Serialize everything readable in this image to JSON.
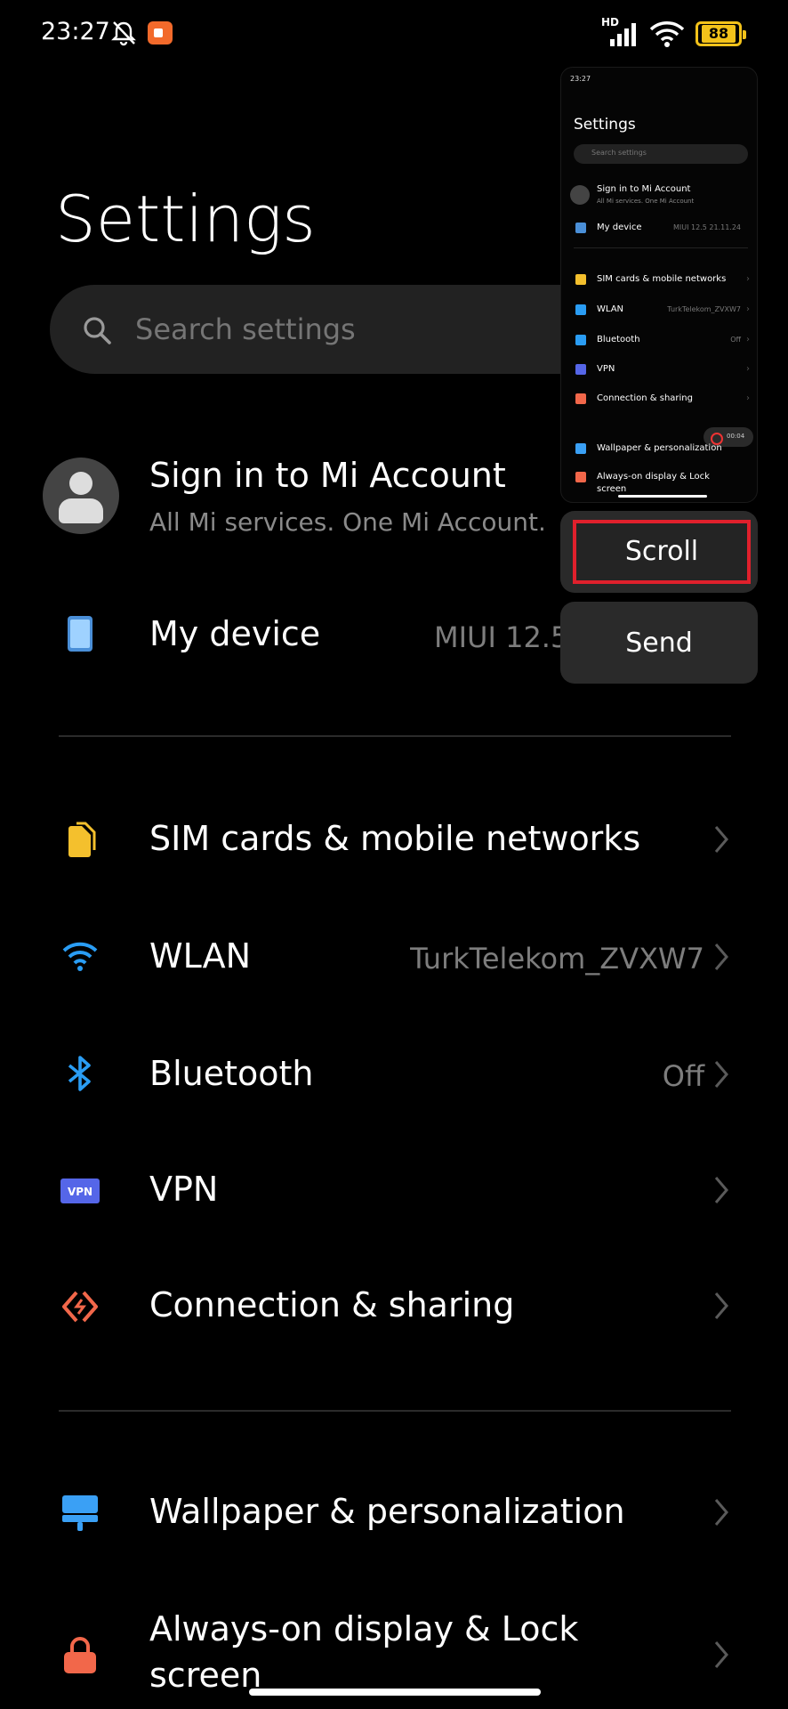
{
  "status_bar": {
    "time": "23:27",
    "network_label": "HD",
    "battery": "88",
    "battery_color": "#f3c21a",
    "icons": [
      "mute-bell-icon",
      "screen-record-icon",
      "signal-icon",
      "wifi-icon",
      "battery-icon"
    ]
  },
  "page": {
    "title": "Settings",
    "search_placeholder": "Search settings"
  },
  "account": {
    "title": "Sign in to Mi Account",
    "subtitle": "All Mi services. One Mi Account."
  },
  "my_device": {
    "label": "My device",
    "value": "MIUI 12.5 21.11.24"
  },
  "network_items": [
    {
      "label": "SIM cards & mobile networks",
      "value": "",
      "icon": "sim-card-icon",
      "color": "#f4c02d"
    },
    {
      "label": "WLAN",
      "value": "TurkTelekom_ZVXW7",
      "icon": "wifi-icon",
      "color": "#2a9df4"
    },
    {
      "label": "Bluetooth",
      "value": "Off",
      "icon": "bluetooth-icon",
      "color": "#2a9df4"
    },
    {
      "label": "VPN",
      "value": "",
      "icon": "vpn-icon",
      "color": "#5566e8"
    },
    {
      "label": "Connection & sharing",
      "value": "",
      "icon": "connection-sharing-icon",
      "color": "#f2674a"
    }
  ],
  "personal_items": [
    {
      "label": "Wallpaper & personalization",
      "value": "",
      "icon": "wallpaper-icon",
      "color": "#3aa0f5"
    },
    {
      "label": "Always-on display & Lock",
      "label2": "screen",
      "value": "",
      "icon": "lock-icon",
      "color": "#f2674a"
    }
  ],
  "overlay": {
    "mini_time": "23:27",
    "mini_title": "Settings",
    "mini_search": "Search settings",
    "mini_account_title": "Sign in to Mi Account",
    "mini_account_sub": "All Mi services. One Mi Account",
    "mini_device_label": "My device",
    "mini_device_value": "MIUI 12.5 21.11.24",
    "mini_items": [
      {
        "label": "SIM cards & mobile networks",
        "value": ""
      },
      {
        "label": "WLAN",
        "value": "TurkTelekom_ZVXW7"
      },
      {
        "label": "Bluetooth",
        "value": "Off"
      },
      {
        "label": "VPN",
        "value": ""
      },
      {
        "label": "Connection & sharing",
        "value": ""
      },
      {
        "label": "Wallpaper & personalization",
        "value": ""
      },
      {
        "label": "Always-on display & Lock",
        "label2": "screen",
        "value": ""
      }
    ],
    "mini_recording_time": "00:04",
    "scroll_button": "Scroll",
    "send_button": "Send",
    "highlight_color": "#e0202c"
  }
}
